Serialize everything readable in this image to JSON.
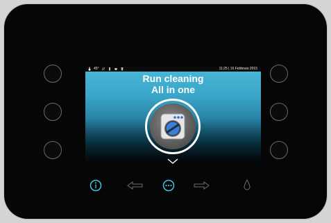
{
  "status_bar": {
    "temperature": "45°",
    "datetime": "11:25 | 16 Febbraio 2015"
  },
  "screen": {
    "title_line1": "Run cleaning",
    "title_line2": "All in one",
    "center_icon": "washing-machine-icon"
  },
  "colors": {
    "accent": "#3fc6de",
    "body": "#060606",
    "side_button_border": "#6a6a6a",
    "nav_icon": "#6f6f6f"
  },
  "bottom_bar": [
    {
      "name": "info-icon",
      "active": true
    },
    {
      "name": "arrow-left-icon",
      "active": false
    },
    {
      "name": "more-icon",
      "active": true
    },
    {
      "name": "arrow-right-icon",
      "active": false
    },
    {
      "name": "water-drop-icon",
      "active": false
    }
  ]
}
